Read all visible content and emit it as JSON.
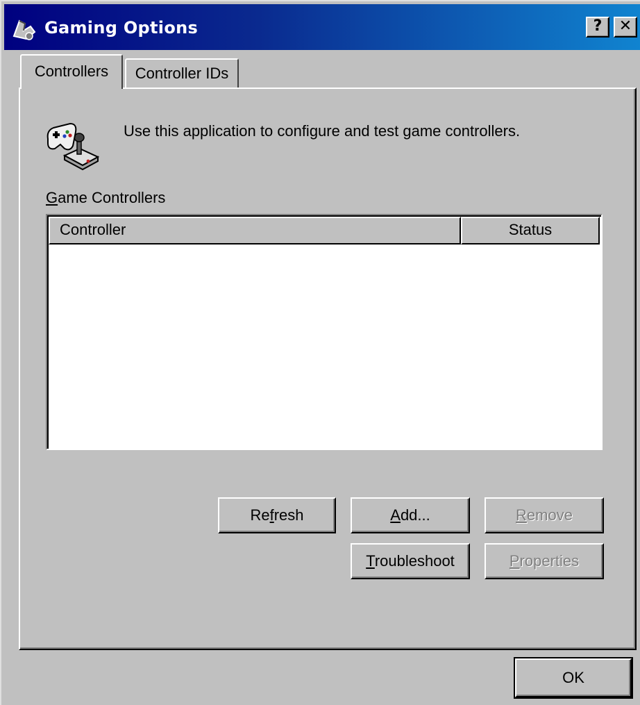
{
  "window": {
    "title": "Gaming Options",
    "help_button": "?",
    "close_button": "✕",
    "title_icon": "gaming-options-icon"
  },
  "tabs": [
    {
      "label": "Controllers",
      "active": true
    },
    {
      "label": "Controller IDs",
      "active": false
    }
  ],
  "description": "Use this application to configure and test game controllers.",
  "game_controllers": {
    "label": "Game Controllers",
    "columns": [
      "Controller",
      "Status"
    ],
    "rows": []
  },
  "buttons": {
    "refresh": "Refresh",
    "add": "Add...",
    "remove": "Remove",
    "troubleshoot": "Troubleshoot",
    "properties": "Properties",
    "ok": "OK"
  },
  "colors": {
    "titlebar_start": "#000080",
    "titlebar_end": "#1084d0",
    "face": "#c0c0c0"
  }
}
